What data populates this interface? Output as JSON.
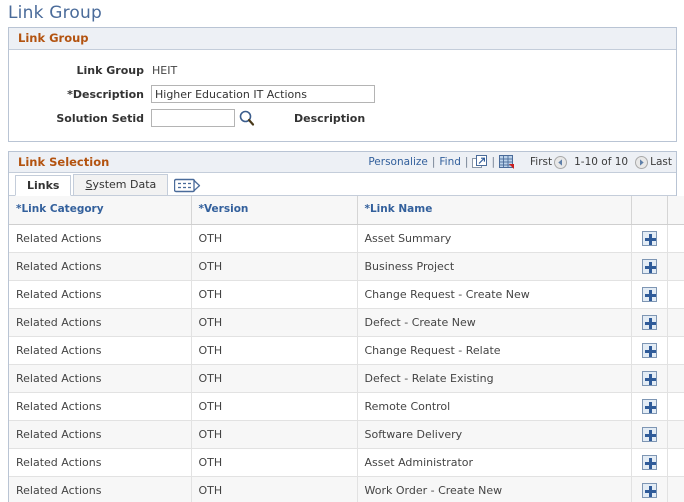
{
  "page": {
    "title": "Link Group"
  },
  "link_group_panel": {
    "header": "Link Group",
    "fields": {
      "link_group_label": "Link Group",
      "link_group_value": "HEIT",
      "description_label": "*Description",
      "description_value": "Higher Education IT Actions",
      "description_placeholder": "",
      "solution_setid_label": "Solution Setid",
      "solution_setid_value": "",
      "solution_setid_placeholder": "",
      "setid_description_label": "Description",
      "lookup_icon": "magnifier-lookup-icon"
    }
  },
  "link_selection_panel": {
    "header": "Link Selection",
    "toolbar": {
      "personalize": "Personalize",
      "find": "Find",
      "separator": "|",
      "view_all_icon": "open-in-new-window-icon",
      "download_icon": "download-to-spreadsheet-icon"
    },
    "pager": {
      "first": "First",
      "previous_icon": "previous-page-icon",
      "range": "1-10 of 10",
      "next_icon": "next-page-icon",
      "last": "Last"
    },
    "tabs": [
      {
        "label": "Links",
        "accesskey": "",
        "active": true
      },
      {
        "label": "System Data",
        "accesskey": "S",
        "active": false
      }
    ],
    "tabs_extra_icon": "show-all-columns-icon",
    "grid": {
      "columns": [
        "*Link Category",
        "*Version",
        "*Link Name",
        "",
        ""
      ],
      "add_row_icon": "add-row-plus-icon",
      "rows": [
        {
          "category": "Related Actions",
          "version": "OTH",
          "name": "Asset Summary"
        },
        {
          "category": "Related Actions",
          "version": "OTH",
          "name": "Business Project"
        },
        {
          "category": "Related Actions",
          "version": "OTH",
          "name": "Change Request - Create New"
        },
        {
          "category": "Related Actions",
          "version": "OTH",
          "name": "Defect - Create New"
        },
        {
          "category": "Related Actions",
          "version": "OTH",
          "name": "Change Request - Relate"
        },
        {
          "category": "Related Actions",
          "version": "OTH",
          "name": "Defect - Relate Existing"
        },
        {
          "category": "Related Actions",
          "version": "OTH",
          "name": "Remote Control"
        },
        {
          "category": "Related Actions",
          "version": "OTH",
          "name": "Software Delivery"
        },
        {
          "category": "Related Actions",
          "version": "OTH",
          "name": "Asset Administrator"
        },
        {
          "category": "Related Actions",
          "version": "OTH",
          "name": "Work Order - Create New"
        }
      ]
    }
  },
  "colors": {
    "page_title": "#4a6b9a",
    "section_header_text": "#b35310",
    "section_header_bg": "#edf0f5",
    "link_blue": "#33609c",
    "grid_header_text": "#33609c",
    "row_alt_bg": "#f7f7f7",
    "border": "#b9c4d4"
  }
}
